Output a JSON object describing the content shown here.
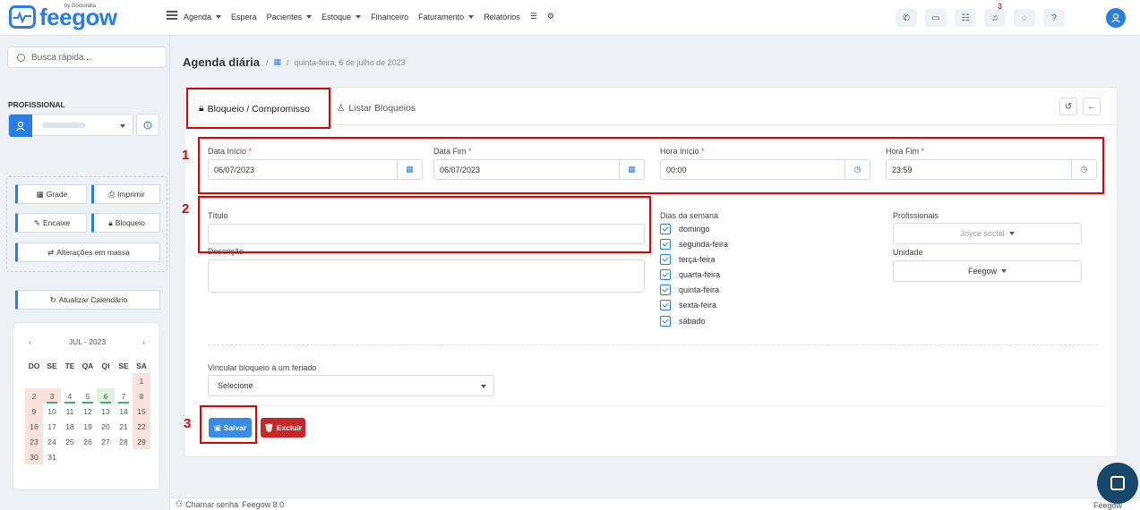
{
  "brand": {
    "name": "feegow",
    "by": "by Doctoralia"
  },
  "nav": [
    {
      "label": "Agenda",
      "caret": true
    },
    {
      "label": "Espera",
      "caret": false
    },
    {
      "label": "Pacientes",
      "caret": true
    },
    {
      "label": "Estoque",
      "caret": true
    },
    {
      "label": "Financeiro",
      "caret": false
    },
    {
      "label": "Faturamento",
      "caret": true
    },
    {
      "label": "Relatórios",
      "caret": false
    }
  ],
  "notifications": {
    "count": "3"
  },
  "sidebar": {
    "search_placeholder": "Busca rápida...",
    "profissional_label": "PROFISSIONAL",
    "buttons": {
      "grade": "Grade",
      "imprimir": "Imprimir",
      "encaixe": "Encaixe",
      "bloqueio": "Bloqueio",
      "alteracoes": "Alterações em massa",
      "atualizar": "Atualizar Calendário"
    },
    "calendar": {
      "month": "JUL - 2023",
      "weekdays": [
        "DO",
        "SE",
        "TE",
        "QA",
        "QI",
        "SE",
        "SA"
      ],
      "weeks": [
        [
          "",
          "",
          "",
          "",
          "",
          "",
          "1"
        ],
        [
          "2",
          "3",
          "4",
          "5",
          "6",
          "7",
          "8"
        ],
        [
          "9",
          "10",
          "11",
          "12",
          "13",
          "14",
          "15"
        ],
        [
          "16",
          "17",
          "18",
          "19",
          "20",
          "21",
          "22"
        ],
        [
          "23",
          "24",
          "25",
          "26",
          "27",
          "28",
          "29"
        ],
        [
          "30",
          "31",
          "",
          "",
          "",
          "",
          ""
        ]
      ]
    }
  },
  "breadcrumb": {
    "title": "Agenda diária",
    "sep": "/",
    "date": "quinta-feira, 6 de julho de 2023"
  },
  "tabs": {
    "active": "Bloqueio / Compromisso",
    "other": "Listar Bloqueios"
  },
  "form": {
    "data_inicio": {
      "label": "Data Início",
      "value": "06/07/2023"
    },
    "data_fim": {
      "label": "Data Fim",
      "value": "06/07/2023"
    },
    "hora_inicio": {
      "label": "Hora Início",
      "value": "00:00"
    },
    "hora_fim": {
      "label": "Hora Fim",
      "value": "23:59"
    },
    "required_mark": "*",
    "titulo_label": "Título",
    "descricao_label": "Descrição",
    "dias_label": "Dias da semana",
    "dias": [
      "domingo",
      "segunda-feira",
      "terça-feira",
      "quarta-feira",
      "quinta-feira",
      "sexta-feira",
      "sábado"
    ],
    "profissionais_label": "Profissionais",
    "profissionais_value": "Joyce social",
    "unidade_label": "Unidade",
    "unidade_value": "Feegow",
    "feriado_label": "Vincular bloqueio à um feriado",
    "feriado_value": "Selecione",
    "salvar": "Salvar",
    "excluir": "Excluir"
  },
  "annotations": [
    "1",
    "2",
    "3"
  ],
  "footer": {
    "chamar": "Chamar senha",
    "version": "Feegow 8.0",
    "right": "Feegow"
  },
  "colors": {
    "primary": "#2a7de1",
    "danger": "#c62828",
    "highlight": "#e30000"
  }
}
